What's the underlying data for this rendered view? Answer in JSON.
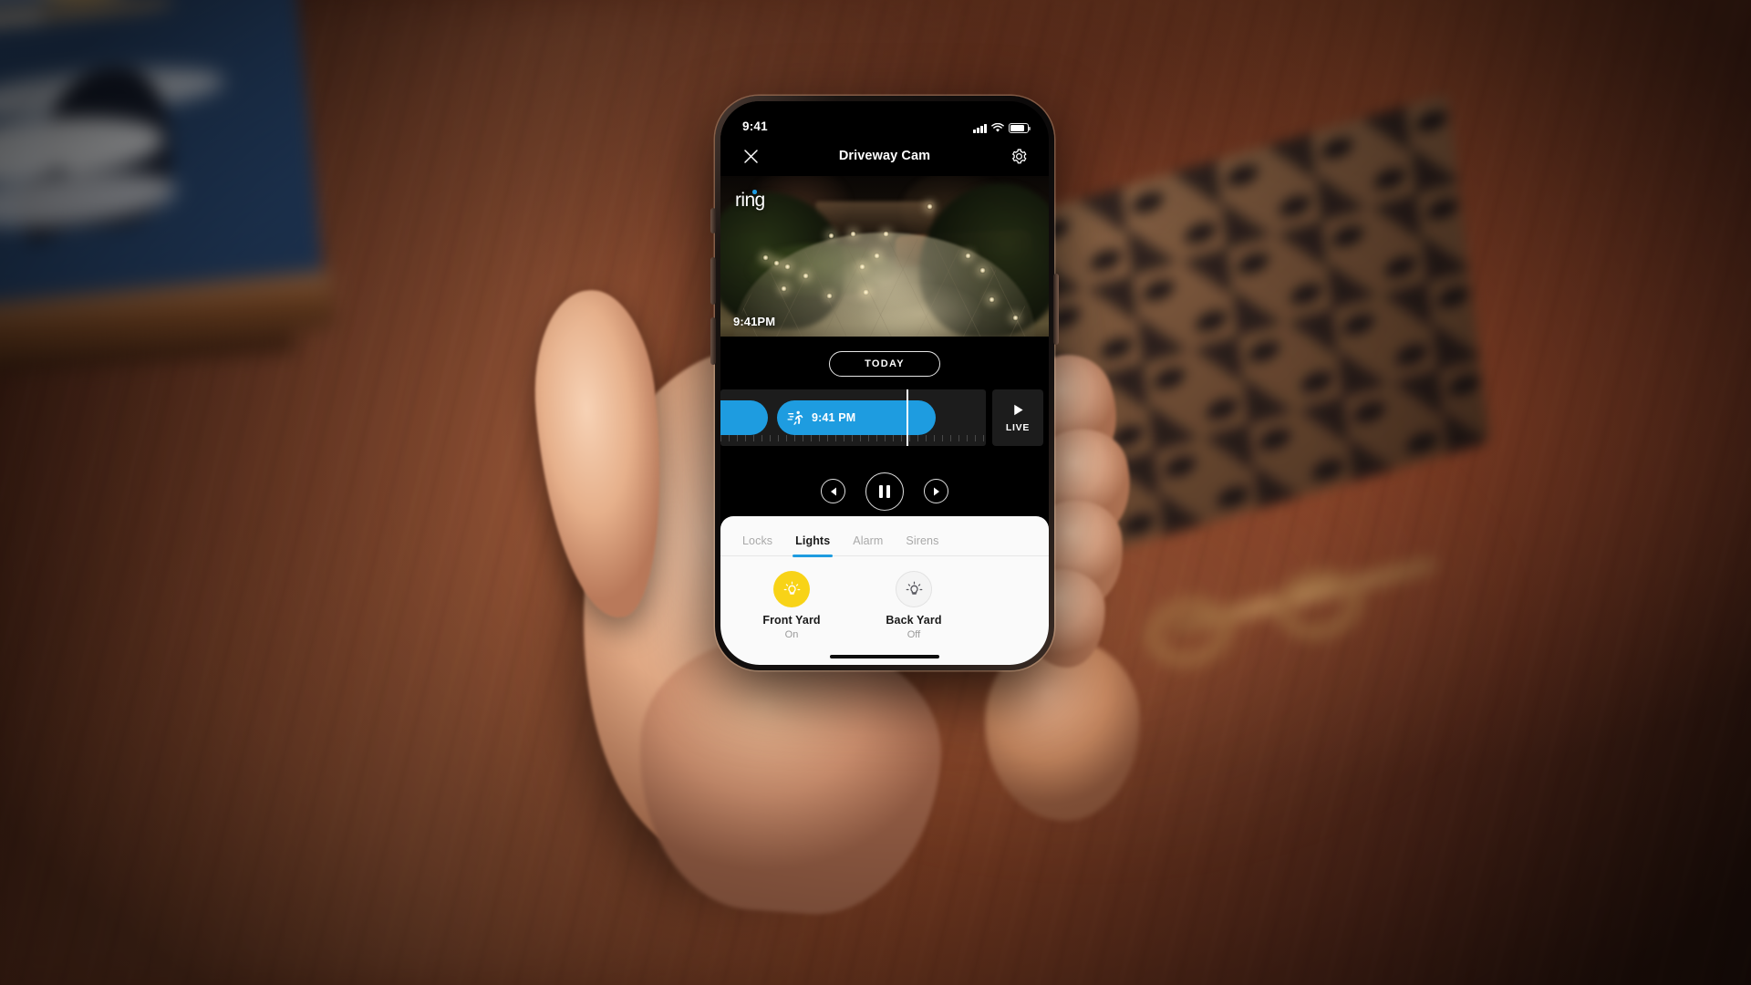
{
  "status_bar": {
    "time": "9:41",
    "signal_icon": "cellular-signal-icon",
    "wifi_icon": "wifi-icon",
    "battery_icon": "battery-icon"
  },
  "navbar": {
    "close_icon": "close-icon",
    "title": "Driveway Cam",
    "settings_icon": "gear-icon"
  },
  "video": {
    "watermark": "ring",
    "timestamp": "9:41PM",
    "scene_description": "night driveway courtyard with landscape lighting"
  },
  "date_selector": {
    "label": "TODAY"
  },
  "timeline": {
    "events": [
      {
        "id": "event-a",
        "label": "",
        "icon": "",
        "color": "#1e9ce0"
      },
      {
        "id": "event-b",
        "label": "9:41 PM",
        "icon": "motion-icon",
        "color": "#1e9ce0"
      }
    ],
    "playhead_time": "9:41 PM",
    "live_button": {
      "label": "LIVE",
      "icon": "play-icon"
    }
  },
  "transport": {
    "previous_label": "previous-event",
    "previous_icon": "skip-back-icon",
    "pause_label": "pause",
    "pause_icon": "pause-icon",
    "next_label": "next-event",
    "next_icon": "skip-forward-icon"
  },
  "sheet": {
    "tabs": [
      {
        "label": "Locks",
        "active": false
      },
      {
        "label": "Lights",
        "active": true
      },
      {
        "label": "Alarm",
        "active": false
      },
      {
        "label": "Sirens",
        "active": false
      }
    ],
    "devices": [
      {
        "name": "Front Yard",
        "state": "On",
        "icon": "lightbulb-icon",
        "on": true
      },
      {
        "name": "Back Yard",
        "state": "Off",
        "icon": "lightbulb-icon",
        "on": false
      }
    ]
  },
  "colors": {
    "accent_blue": "#1e9ce0",
    "light_on_yellow": "#f8d317",
    "sheet_background": "#fafafa",
    "screen_background": "#000000"
  }
}
